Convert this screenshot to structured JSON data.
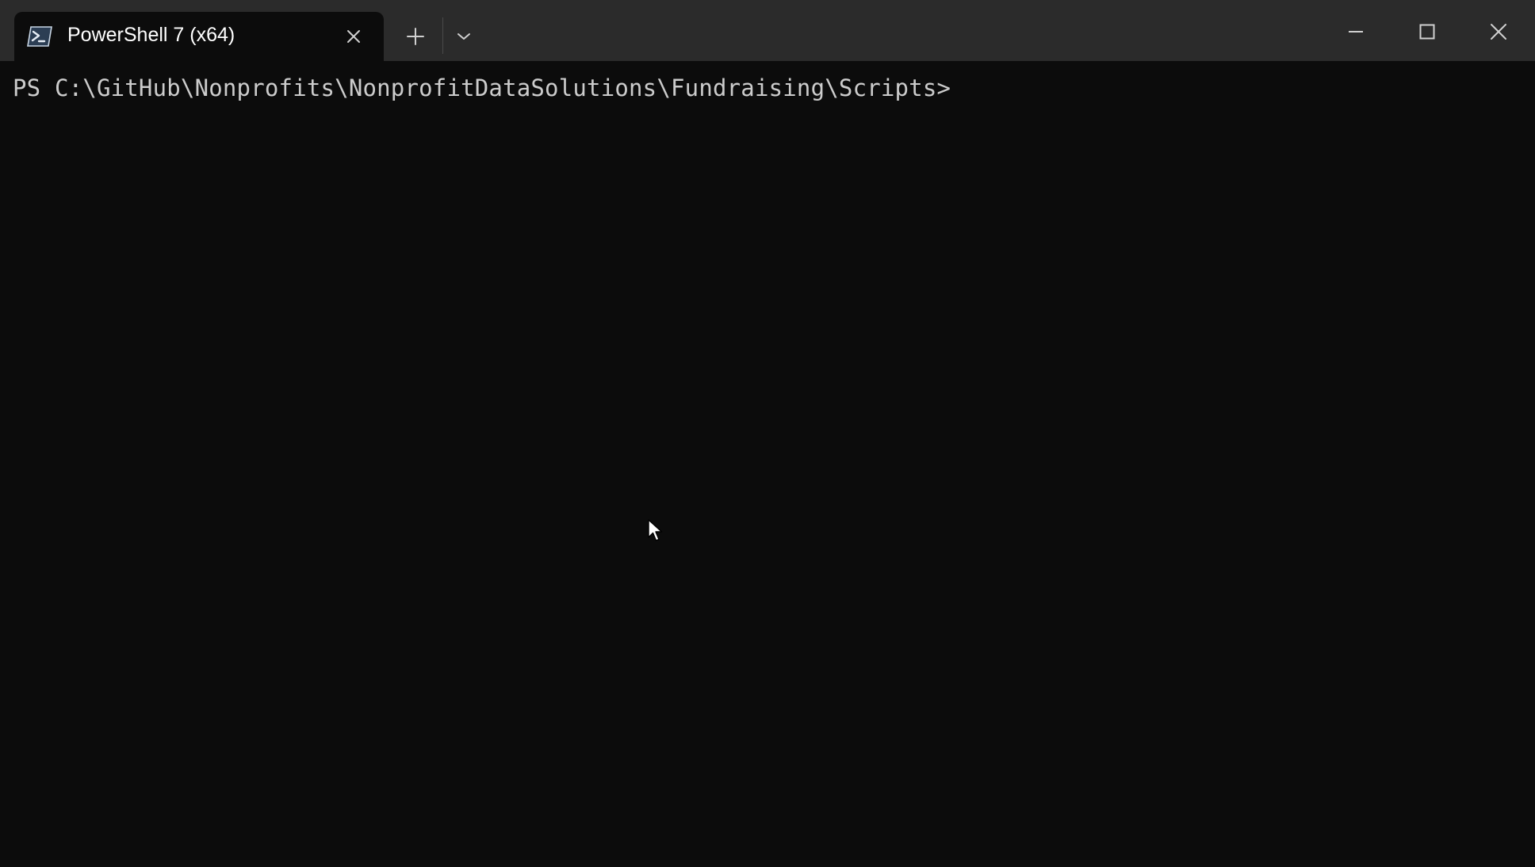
{
  "window": {
    "tab_title": "PowerShell 7 (x64)",
    "tab_icon": "powershell-icon",
    "icons": {
      "tab_close": "close-icon",
      "new_tab": "plus-icon",
      "dropdown": "chevron-down-icon",
      "minimize": "minimize-icon",
      "maximize": "maximize-icon",
      "close": "close-icon"
    }
  },
  "terminal": {
    "prompt": "PS C:\\GitHub\\Nonprofits\\NonprofitDataSolutions\\Fundraising\\Scripts>"
  },
  "colors": {
    "titlebar": "#2b2b2b",
    "background": "#0c0c0c",
    "text": "#cccccc",
    "tab_title": "#ffffff"
  }
}
